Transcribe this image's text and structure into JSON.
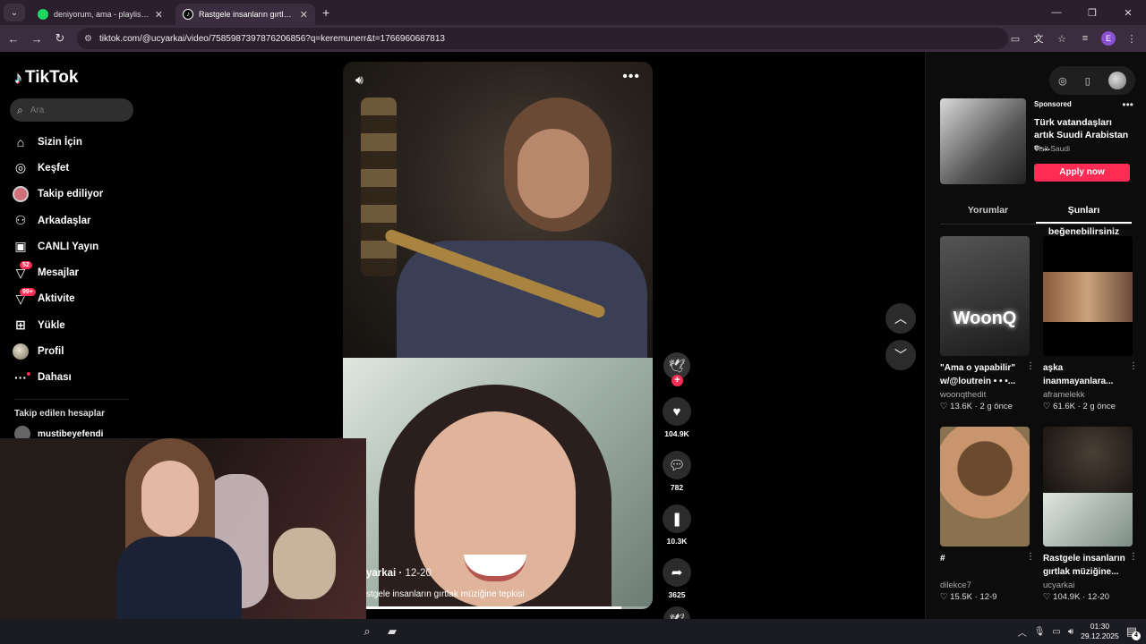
{
  "browser": {
    "tabs": [
      {
        "title": "deniyorum, ama - playlist by",
        "icon": "spotify-icon",
        "color": "#1ed760",
        "active": false
      },
      {
        "title": "Rastgele insanların gırtlak müzi",
        "icon": "tiktok-icon",
        "color": "#000000",
        "active": true
      }
    ],
    "new_tab": "+",
    "url": "tiktok.com/@ucyarkai/video/7585987397876206856?q=keremunerr&t=1766960687813"
  },
  "sidebar": {
    "logo": "TikTok",
    "search_placeholder": "Ara",
    "items": [
      {
        "label": "Sizin İçin",
        "icon": "home-icon"
      },
      {
        "label": "Keşfet",
        "icon": "compass-icon"
      },
      {
        "label": "Takip ediliyor",
        "icon": "following-icon"
      },
      {
        "label": "Arkadaşlar",
        "icon": "friends-icon"
      },
      {
        "label": "CANLI Yayın",
        "icon": "live-icon"
      },
      {
        "label": "Mesajlar",
        "icon": "messages-icon",
        "badge": "52"
      },
      {
        "label": "Aktivite",
        "icon": "activity-icon",
        "badge": "99+"
      },
      {
        "label": "Yükle",
        "icon": "upload-icon"
      },
      {
        "label": "Profil",
        "icon": "profile-icon"
      },
      {
        "label": "Dahası",
        "icon": "more-icon"
      }
    ],
    "followed_title": "Takip edilen hesaplar",
    "followed_accounts": [
      "mustibeyefendi"
    ]
  },
  "video": {
    "author": "ucyarkai",
    "author_visible": "yarkai",
    "date": "12-20",
    "caption_visible": "stgele insanların gırtlak müziğine tepkisi",
    "progress": 0.9
  },
  "actions": {
    "likes": "104.9K",
    "comments": "782",
    "saves": "10.3K",
    "shares": "3625"
  },
  "right_panel": {
    "ad": {
      "sponsored": "Sponsored",
      "title": "Türk vatandaşları artık Suudi Arabistan e-...",
      "advertiser": "Visit Saudi",
      "cta": "Apply now"
    },
    "tabs": [
      {
        "label": "Yorumlar",
        "active": false
      },
      {
        "label": "Şunları beğenebilirsiniz",
        "active": true
      }
    ],
    "cards": [
      {
        "title": "\"Ama o yapabilir\" w/@loutrein • • •...",
        "author": "woonqthedit",
        "likes": "13.6K",
        "time": "2 g önce",
        "overlay": "WoonQ"
      },
      {
        "title": "aşka inanmayanlara...",
        "author": "aframelekk",
        "likes": "61.6K",
        "time": "2 g önce"
      },
      {
        "title": "#",
        "author": "dilekce7",
        "likes": "15.5K",
        "time": "12-9"
      },
      {
        "title": "Rastgele insanların gırtlak müziğine...",
        "author": "ucyarkai",
        "likes": "104.9K",
        "time": "12-20"
      }
    ]
  },
  "taskbar": {
    "time": "01:30",
    "date": "29.12.2025",
    "notifications": "4"
  },
  "colors": {
    "accent": "#fe2c55",
    "background": "#000000",
    "browser_frame": "#3b2d3f"
  }
}
